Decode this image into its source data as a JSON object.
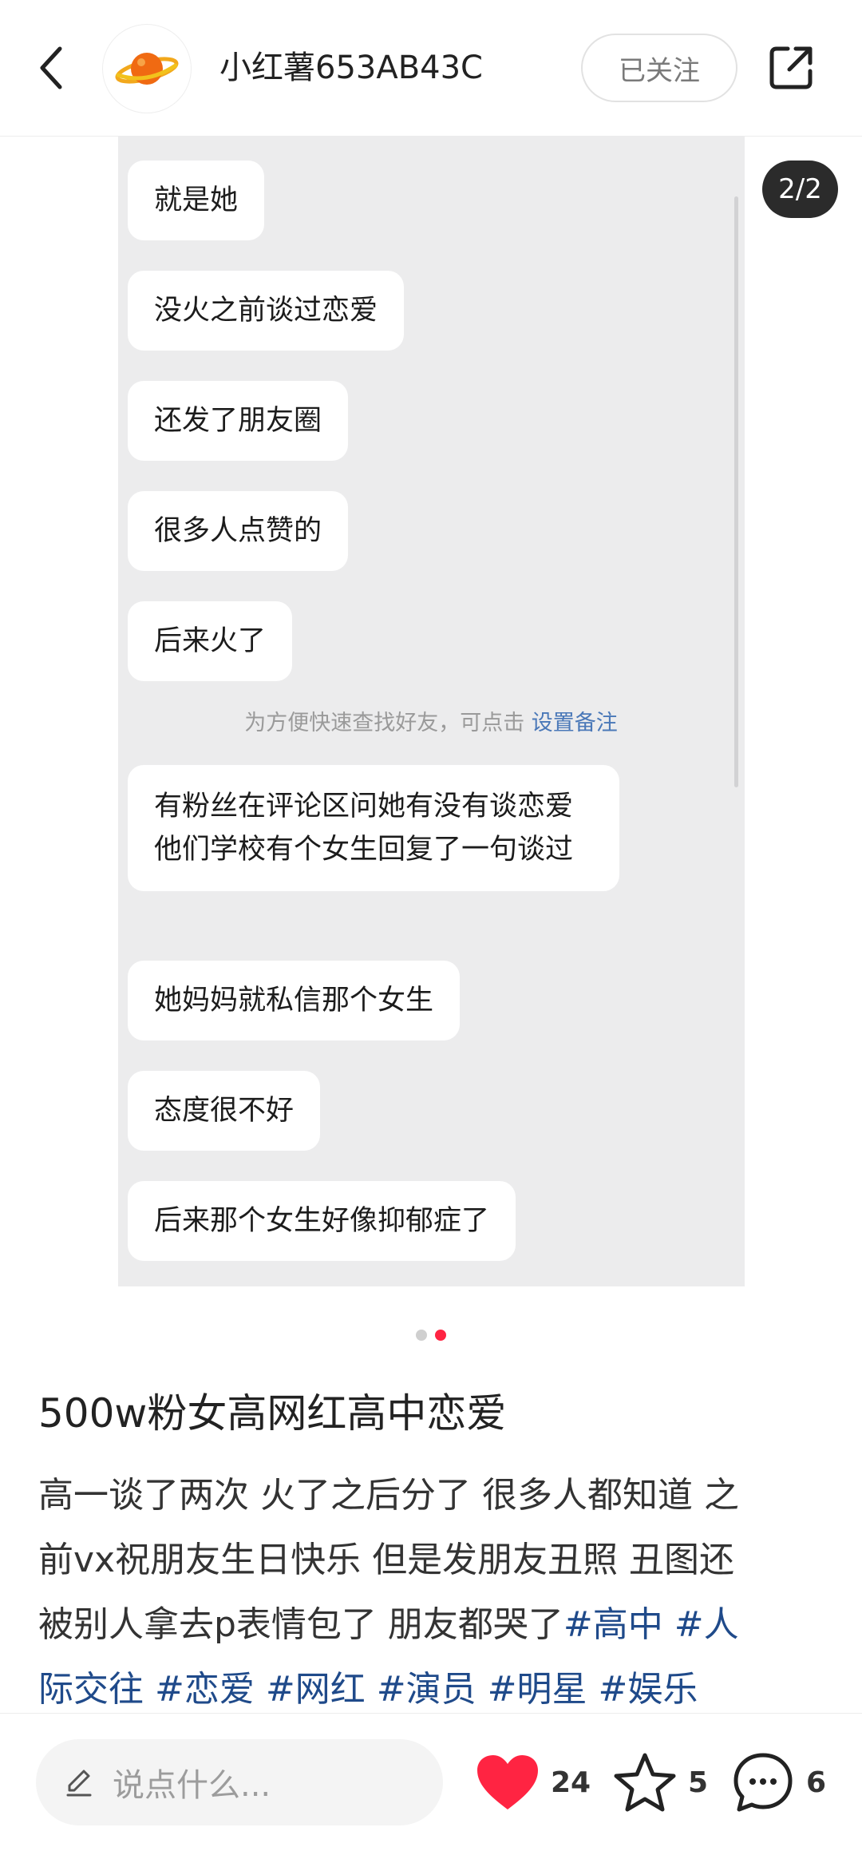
{
  "header": {
    "username": "小红薯653AB43C",
    "follow_label": "已关注"
  },
  "media": {
    "page_indicator": "2/2",
    "page_count": 2,
    "current_page": 2,
    "chat_messages": [
      "就是她",
      "没火之前谈过恋爱",
      "还发了朋友圈",
      "很多人点赞的",
      "后来火了",
      "有粉丝在评论区问她有没有谈恋爱 他们学校有个女生回复了一句谈过",
      "她妈妈就私信那个女生",
      "态度很不好",
      "后来那个女生好像抑郁症了"
    ],
    "system_note": {
      "text": "为方便快速查找好友，可点击",
      "link": "设置备注"
    }
  },
  "post": {
    "title": "500w粉女高网红高中恋爱",
    "body_lines": [
      "高一谈了两次 火了之后分了 很多人都知道 之",
      "前vx祝朋友生日快乐 但是发朋友丑照 丑图还",
      "被别人拿去p表情包了 朋友都哭了"
    ],
    "tags": [
      "#高中",
      "#人际交往",
      "#恋爱",
      "#网红",
      "#演员",
      "#明星",
      "#娱乐"
    ]
  },
  "bottom_bar": {
    "comment_placeholder": "说点什么...",
    "likes": "24",
    "favorites": "5",
    "comments": "6"
  },
  "colors": {
    "accent": "#ff2442",
    "tag": "#1f4a8a",
    "chat_bg": "#ececed",
    "link": "#4a78b8"
  },
  "icons": [
    "chevron-left-icon",
    "planet-avatar-icon",
    "share-icon",
    "pen-icon",
    "heart-icon",
    "star-icon",
    "comment-bubble-icon"
  ]
}
